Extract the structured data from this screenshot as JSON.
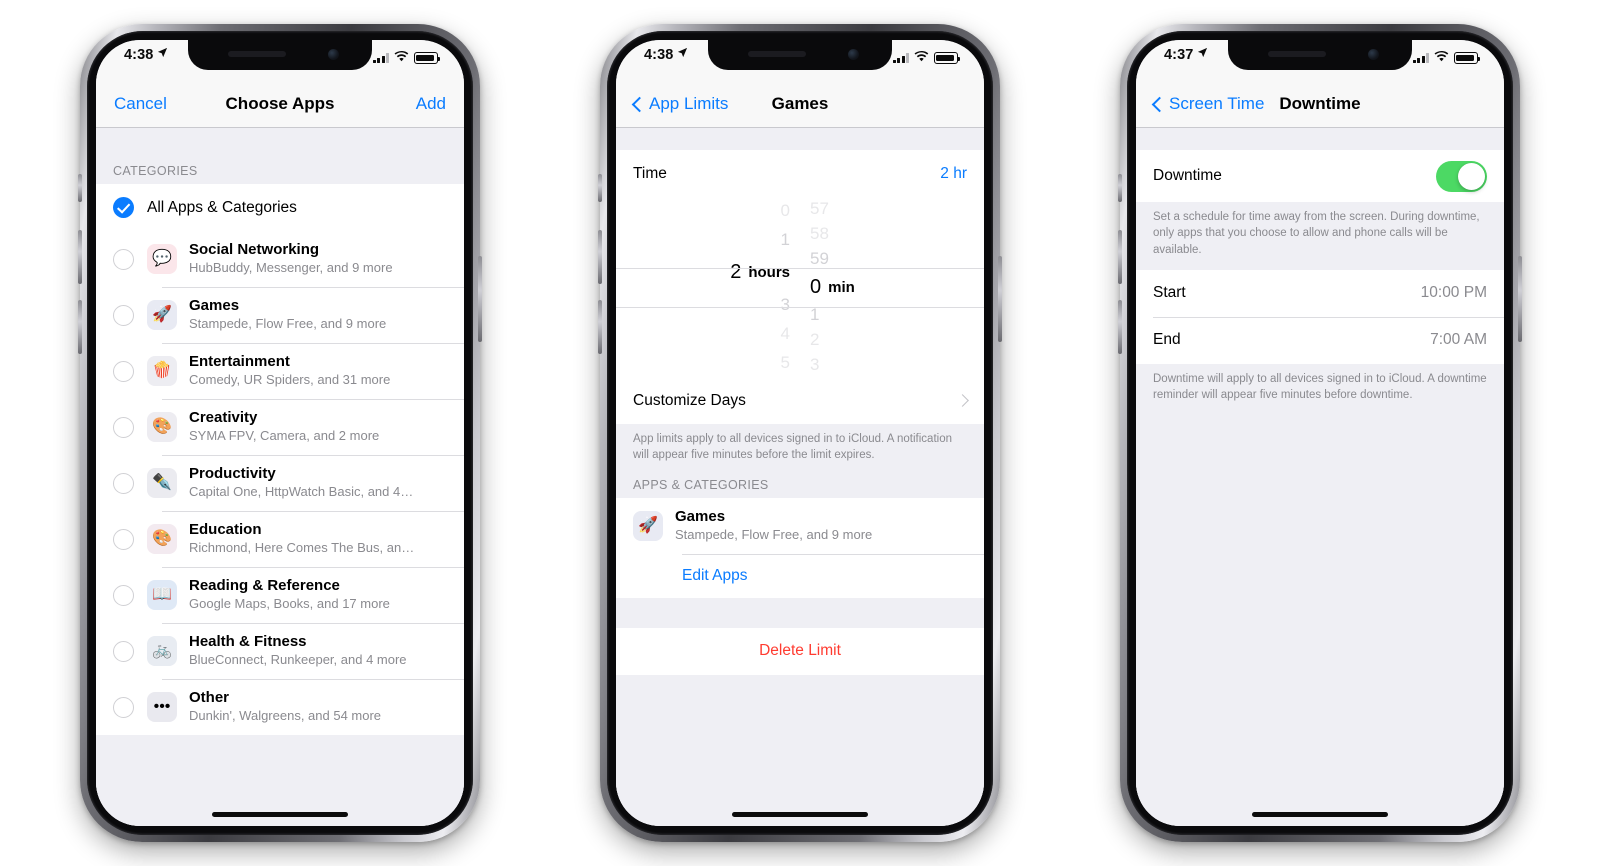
{
  "colors": {
    "accent_blue": "#0a7cff",
    "destructive_red": "#ff3b30",
    "toggle_green": "#4cd964",
    "group_bg": "#efeff4",
    "row_bg": "#ffffff",
    "secondary_text": "#8a8a8f"
  },
  "phones": [
    {
      "id": "choose-apps",
      "status": {
        "time": "4:38",
        "location_icon": "location-arrow-icon",
        "signal_icon": "cellular-signal-icon",
        "wifi_icon": "wifi-icon",
        "battery_icon": "battery-icon"
      },
      "nav": {
        "left": "Cancel",
        "title": "Choose Apps",
        "right": "Add"
      },
      "section_header": "CATEGORIES",
      "all_apps": {
        "label": "All Apps & Categories",
        "selected": true,
        "control": "checkmark-filled-icon"
      },
      "categories": [
        {
          "name": "Social Networking",
          "subtitle": "HubBuddy, Messenger, and 9 more",
          "icon": "social-networking-icon",
          "glyph": "💬",
          "tint": "#fbe6ea",
          "selected": false
        },
        {
          "name": "Games",
          "subtitle": "Stampede, Flow Free, and 9 more",
          "icon": "games-rocket-icon",
          "glyph": "🚀",
          "tint": "#e8eaf3",
          "selected": false
        },
        {
          "name": "Entertainment",
          "subtitle": "Comedy, UR Spiders, and 31 more",
          "icon": "entertainment-popcorn-icon",
          "glyph": "🍿",
          "tint": "#ededf2",
          "selected": false
        },
        {
          "name": "Creativity",
          "subtitle": "SYMA FPV, Camera, and 2 more",
          "icon": "creativity-palette-icon",
          "glyph": "🎨",
          "tint": "#edecf1",
          "selected": false
        },
        {
          "name": "Productivity",
          "subtitle": "Capital One, HttpWatch Basic, and 4…",
          "icon": "productivity-pen-icon",
          "glyph": "✒️",
          "tint": "#ebebf0",
          "selected": false
        },
        {
          "name": "Education",
          "subtitle": "Richmond, Here Comes The Bus, an…",
          "icon": "education-art-icon",
          "glyph": "🎨",
          "tint": "#f3eaf0",
          "selected": false
        },
        {
          "name": "Reading & Reference",
          "subtitle": "Google Maps, Books, and 17 more",
          "icon": "reading-book-icon",
          "glyph": "📖",
          "tint": "#dfe9f6",
          "selected": false
        },
        {
          "name": "Health & Fitness",
          "subtitle": "BlueConnect, Runkeeper, and 4 more",
          "icon": "health-bicycle-icon",
          "glyph": "🚲",
          "tint": "#e8ecf2",
          "selected": false
        },
        {
          "name": "Other",
          "subtitle": "Dunkin', Walgreens, and 54 more",
          "icon": "other-ellipsis-icon",
          "glyph": "•••",
          "tint": "#e9e9ef",
          "selected": false
        }
      ]
    },
    {
      "id": "games-limit",
      "status": {
        "time": "4:38"
      },
      "nav": {
        "back": "App Limits",
        "title": "Games"
      },
      "time_row": {
        "label": "Time",
        "value": "2 hr"
      },
      "picker": {
        "hours": {
          "above": [
            "0",
            "1"
          ],
          "selected": "2",
          "unit": "hours",
          "below": [
            "3",
            "4",
            "5"
          ]
        },
        "minutes": {
          "above": [
            "57",
            "58",
            "59"
          ],
          "selected": "0",
          "unit": "min",
          "below": [
            "1",
            "2",
            "3"
          ]
        }
      },
      "customize_days": {
        "label": "Customize Days",
        "chevron": "chevron-right-icon"
      },
      "footnote": "App limits apply to all devices signed in to iCloud. A notification will appear five minutes before the limit expires.",
      "apps_header": "APPS & CATEGORIES",
      "app": {
        "name": "Games",
        "subtitle": "Stampede, Flow Free, and 9 more",
        "icon": "games-rocket-icon",
        "glyph": "🚀",
        "tint": "#e8eaf3"
      },
      "edit_apps": "Edit Apps",
      "delete_limit": "Delete Limit"
    },
    {
      "id": "downtime",
      "status": {
        "time": "4:37"
      },
      "nav": {
        "back": "Screen Time",
        "title": "Downtime"
      },
      "downtime_toggle": {
        "label": "Downtime",
        "on": true
      },
      "description": "Set a schedule for time away from the screen. During downtime, only apps that you choose to allow and phone calls will be available.",
      "schedule": [
        {
          "label": "Start",
          "value": "10:00 PM"
        },
        {
          "label": "End",
          "value": "7:00 AM"
        }
      ],
      "footnote": "Downtime will apply to all devices signed in to iCloud. A downtime reminder will appear five minutes before downtime."
    }
  ]
}
